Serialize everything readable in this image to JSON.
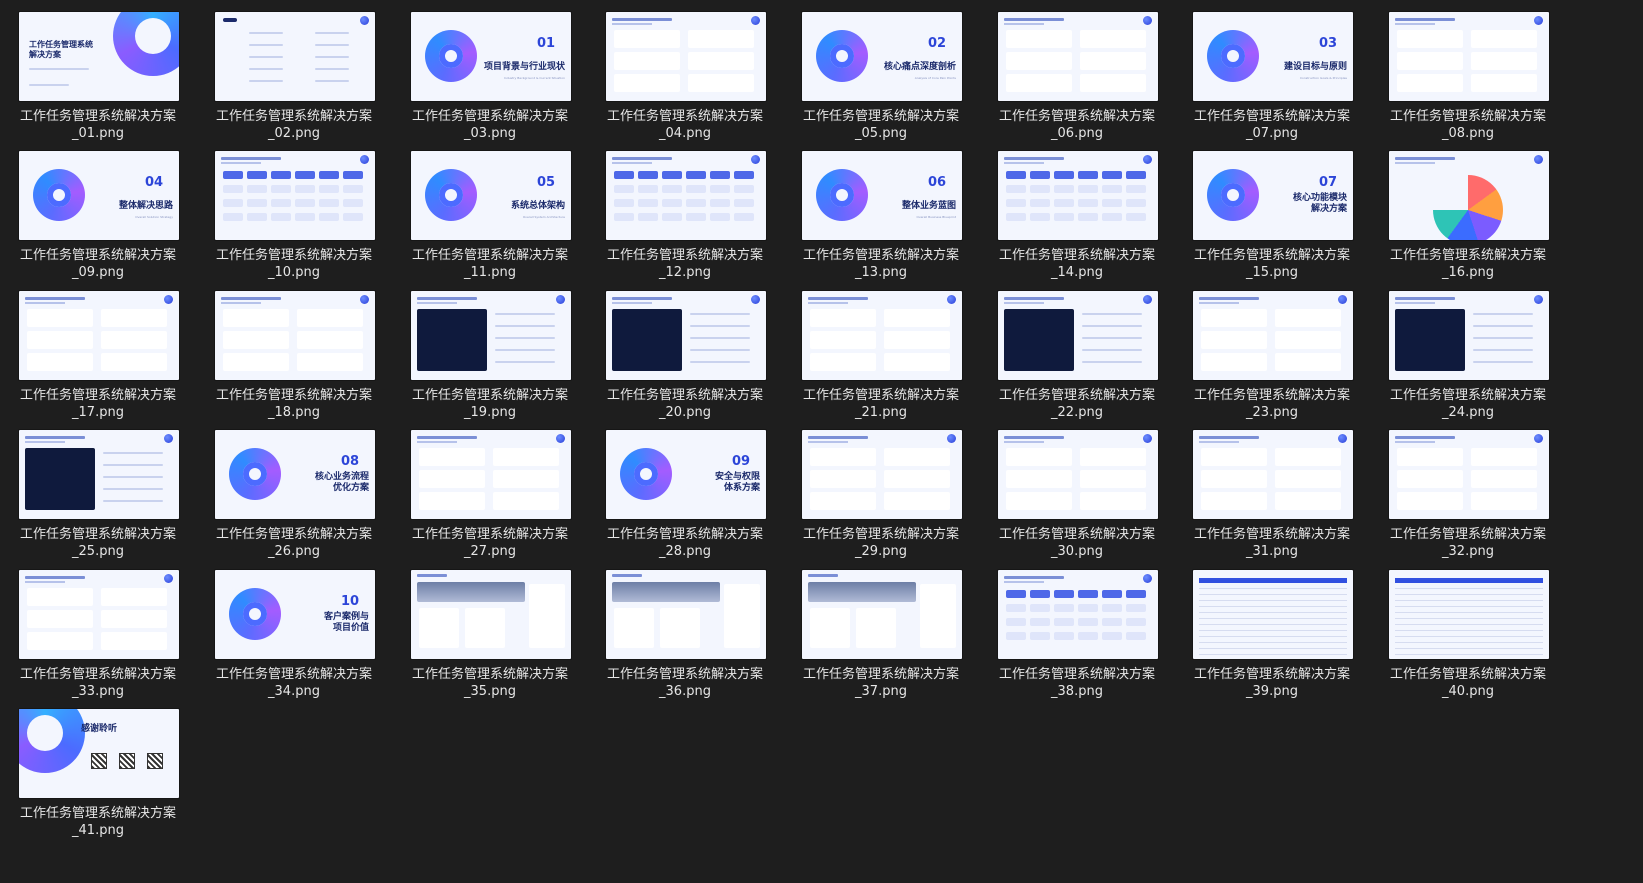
{
  "files": [
    {
      "name_line1": "工作任务管理系统解决方案",
      "name_line2": "_01.png",
      "kind": "cover",
      "title": "工作任务管理系统\n解决方案"
    },
    {
      "name_line1": "工作任务管理系统解决方案",
      "name_line2": "_02.png",
      "kind": "toc",
      "title": "目 录"
    },
    {
      "name_line1": "工作任务管理系统解决方案",
      "name_line2": "_03.png",
      "kind": "section",
      "num": "01",
      "title": "项目背景与行业现状",
      "sub": "Industry Background & Current Situation"
    },
    {
      "name_line1": "工作任务管理系统解决方案",
      "name_line2": "_04.png",
      "kind": "content",
      "title": "项目背景与行业现状"
    },
    {
      "name_line1": "工作任务管理系统解决方案",
      "name_line2": "_05.png",
      "kind": "section",
      "num": "02",
      "title": "核心痛点深度剖析",
      "sub": "Analysis of Core Pain Points"
    },
    {
      "name_line1": "工作任务管理系统解决方案",
      "name_line2": "_06.png",
      "kind": "content",
      "title": ""
    },
    {
      "name_line1": "工作任务管理系统解决方案",
      "name_line2": "_07.png",
      "kind": "section",
      "num": "03",
      "title": "建设目标与原则",
      "sub": "Construction Goals & Principles"
    },
    {
      "name_line1": "工作任务管理系统解决方案",
      "name_line2": "_08.png",
      "kind": "content",
      "title": ""
    },
    {
      "name_line1": "工作任务管理系统解决方案",
      "name_line2": "_09.png",
      "kind": "section",
      "num": "04",
      "title": "整体解决思路",
      "sub": "Overall Solution Strategy"
    },
    {
      "name_line1": "工作任务管理系统解决方案",
      "name_line2": "_10.png",
      "kind": "content",
      "title": "整体建设思路"
    },
    {
      "name_line1": "工作任务管理系统解决方案",
      "name_line2": "_11.png",
      "kind": "section",
      "num": "05",
      "title": "系统总体架构",
      "sub": "Overall System Architecture"
    },
    {
      "name_line1": "工作任务管理系统解决方案",
      "name_line2": "_12.png",
      "kind": "content",
      "title": "系统总体架构"
    },
    {
      "name_line1": "工作任务管理系统解决方案",
      "name_line2": "_13.png",
      "kind": "section",
      "num": "06",
      "title": "整体业务蓝图",
      "sub": "Overall Business Blueprint"
    },
    {
      "name_line1": "工作任务管理系统解决方案",
      "name_line2": "_14.png",
      "kind": "content",
      "title": "业务流程图"
    },
    {
      "name_line1": "工作任务管理系统解决方案",
      "name_line2": "_15.png",
      "kind": "section",
      "num": "07",
      "title": "核心功能模块\n解决方案",
      "sub": ""
    },
    {
      "name_line1": "工作任务管理系统解决方案",
      "name_line2": "_16.png",
      "kind": "content",
      "title": ""
    },
    {
      "name_line1": "工作任务管理系统解决方案",
      "name_line2": "_17.png",
      "kind": "content",
      "title": "核心功能"
    },
    {
      "name_line1": "工作任务管理系统解决方案",
      "name_line2": "_18.png",
      "kind": "content",
      "title": "核心功能：AI智能规划"
    },
    {
      "name_line1": "工作任务管理系统解决方案",
      "name_line2": "_19.png",
      "kind": "content",
      "title": "核心功能：AI分析报告"
    },
    {
      "name_line1": "工作任务管理系统解决方案",
      "name_line2": "_20.png",
      "kind": "content",
      "title": "核心功能：任务中心"
    },
    {
      "name_line1": "工作任务管理系统解决方案",
      "name_line2": "_21.png",
      "kind": "content",
      "title": "核心功能：任务调度"
    },
    {
      "name_line1": "工作任务管理系统解决方案",
      "name_line2": "_22.png",
      "kind": "content",
      "title": "核心功能：任务执行看板"
    },
    {
      "name_line1": "工作任务管理系统解决方案",
      "name_line2": "_23.png",
      "kind": "content",
      "title": "核心功能：评分与排名"
    },
    {
      "name_line1": "工作任务管理系统解决方案",
      "name_line2": "_24.png",
      "kind": "content",
      "title": "核心功能：数据驾驶舱"
    },
    {
      "name_line1": "工作任务管理系统解决方案",
      "name_line2": "_25.png",
      "kind": "content",
      "title": "核心功能：数据智能分析"
    },
    {
      "name_line1": "工作任务管理系统解决方案",
      "name_line2": "_26.png",
      "kind": "section",
      "num": "08",
      "title": "核心业务流程\n优化方案",
      "sub": ""
    },
    {
      "name_line1": "工作任务管理系统解决方案",
      "name_line2": "_27.png",
      "kind": "content",
      "title": "核心业务流程优化方案"
    },
    {
      "name_line1": "工作任务管理系统解决方案",
      "name_line2": "_28.png",
      "kind": "section",
      "num": "09",
      "title": "安全与权限\n体系方案",
      "sub": ""
    },
    {
      "name_line1": "工作任务管理系统解决方案",
      "name_line2": "_29.png",
      "kind": "content",
      "title": "安全与权限体系方案"
    },
    {
      "name_line1": "工作任务管理系统解决方案",
      "name_line2": "_30.png",
      "kind": "content",
      "title": "多端认证守护数据安全"
    },
    {
      "name_line1": "工作任务管理系统解决方案",
      "name_line2": "_31.png",
      "kind": "content",
      "title": "多端认证守护数据安全"
    },
    {
      "name_line1": "工作任务管理系统解决方案",
      "name_line2": "_32.png",
      "kind": "content",
      "title": "多端认证守护数据安全"
    },
    {
      "name_line1": "工作任务管理系统解决方案",
      "name_line2": "_33.png",
      "kind": "content",
      "title": "多端认证与权限保护"
    },
    {
      "name_line1": "工作任务管理系统解决方案",
      "name_line2": "_34.png",
      "kind": "section",
      "num": "10",
      "title": "客户案例与\n项目价值",
      "sub": ""
    },
    {
      "name_line1": "工作任务管理系统解决方案",
      "name_line2": "_35.png",
      "kind": "case",
      "title": "客户案例"
    },
    {
      "name_line1": "工作任务管理系统解决方案",
      "name_line2": "_36.png",
      "kind": "case",
      "title": "客户案例"
    },
    {
      "name_line1": "工作任务管理系统解决方案",
      "name_line2": "_37.png",
      "kind": "case",
      "title": "客户案例"
    },
    {
      "name_line1": "工作任务管理系统解决方案",
      "name_line2": "_38.png",
      "kind": "content",
      "title": "项目价值与实施计划"
    },
    {
      "name_line1": "工作任务管理系统解决方案",
      "name_line2": "_39.png",
      "kind": "table",
      "title": "工作任务管理系统功能"
    },
    {
      "name_line1": "工作任务管理系统解决方案",
      "name_line2": "_40.png",
      "kind": "table",
      "title": "工作任务管理系统功能"
    },
    {
      "name_line1": "工作任务管理系统解决方案",
      "name_line2": "_41.png",
      "kind": "thanks",
      "title": "感谢聆听"
    }
  ],
  "colors": {
    "background": "#1e1e1e",
    "caption": "#e6e6e6",
    "slide_bg": "#f3f6fe",
    "accent": "#2c45d8",
    "dark_panel": "#0f1a3d"
  }
}
